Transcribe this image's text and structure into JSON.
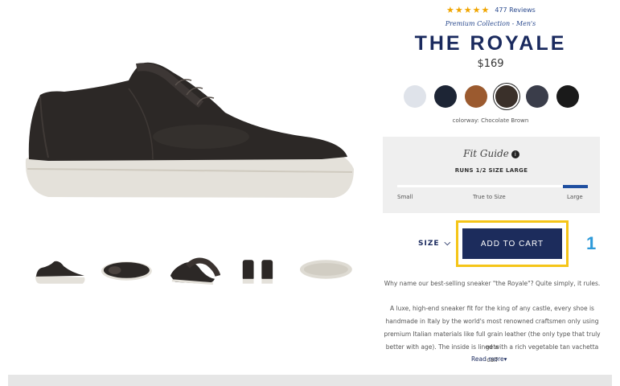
{
  "rating": {
    "stars": "★★★★★",
    "reviews": "477 Reviews"
  },
  "product": {
    "collection": "Premium Collection - Men's",
    "name": "THE ROYALE",
    "price": "$169",
    "colorway": "colorway: Chocolate Brown"
  },
  "swatches": [
    {
      "name": "white",
      "color": "#dfe3ea"
    },
    {
      "name": "navy",
      "color": "#1d2535"
    },
    {
      "name": "tan",
      "color": "#9b5a2f"
    },
    {
      "name": "chocolate",
      "color": "#3a302a",
      "selected": true
    },
    {
      "name": "slate",
      "color": "#3a3d4a"
    },
    {
      "name": "black",
      "color": "#1a1a1a"
    }
  ],
  "fit_guide": {
    "title": "Fit Guide",
    "runs": "RUNS 1/2 SIZE LARGE",
    "labels": {
      "small": "Small",
      "true": "True to Size",
      "large": "Large"
    },
    "level": 1.0
  },
  "size": {
    "label": "SIZE"
  },
  "cart": {
    "label": "ADD TO CART"
  },
  "annotation": {
    "number": "1"
  },
  "description": {
    "p1": "Why name our best-selling sneaker \"the Royale\"? Quite simply, it rules.",
    "p2_l1": "A luxe, high-end sneaker fit for the king of any castle, every shoe is",
    "p2_l2": "handmade in Italy by the world's most renowned craftsmen only using",
    "p2_l3": "premium Italian materials like full grain leather (the only type that truly gets",
    "p2_l4": "better with age). The inside is lined with a rich vegetable tan vachetta calf",
    "read_more": "Read more"
  },
  "colors": {
    "accent": "#1c2c5c",
    "highlight": "#f5c518",
    "stars": "#f0a500"
  }
}
